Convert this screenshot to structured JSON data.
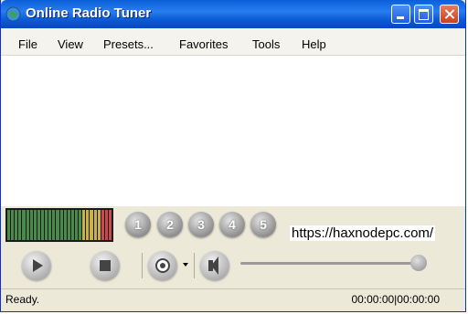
{
  "window": {
    "title": "Online Radio Tuner"
  },
  "menu": [
    "File",
    "View",
    "Presets...",
    "Favorites",
    "Tools",
    "Help"
  ],
  "presets": [
    "1",
    "2",
    "3",
    "4",
    "5"
  ],
  "watermark": "https://haxnodepc.com/",
  "controls": {
    "play_icon": "play-icon",
    "stop_icon": "stop-icon",
    "record_icon": "record-icon",
    "volume_icon": "speaker-icon",
    "volume_level": 0.97
  },
  "status": {
    "text": "Ready.",
    "time": "00:00:00|00:00:00"
  },
  "colors": {
    "titlebar": "#0a5fd8",
    "close_button": "#c7421f",
    "window_bg": "#ece9d8"
  }
}
